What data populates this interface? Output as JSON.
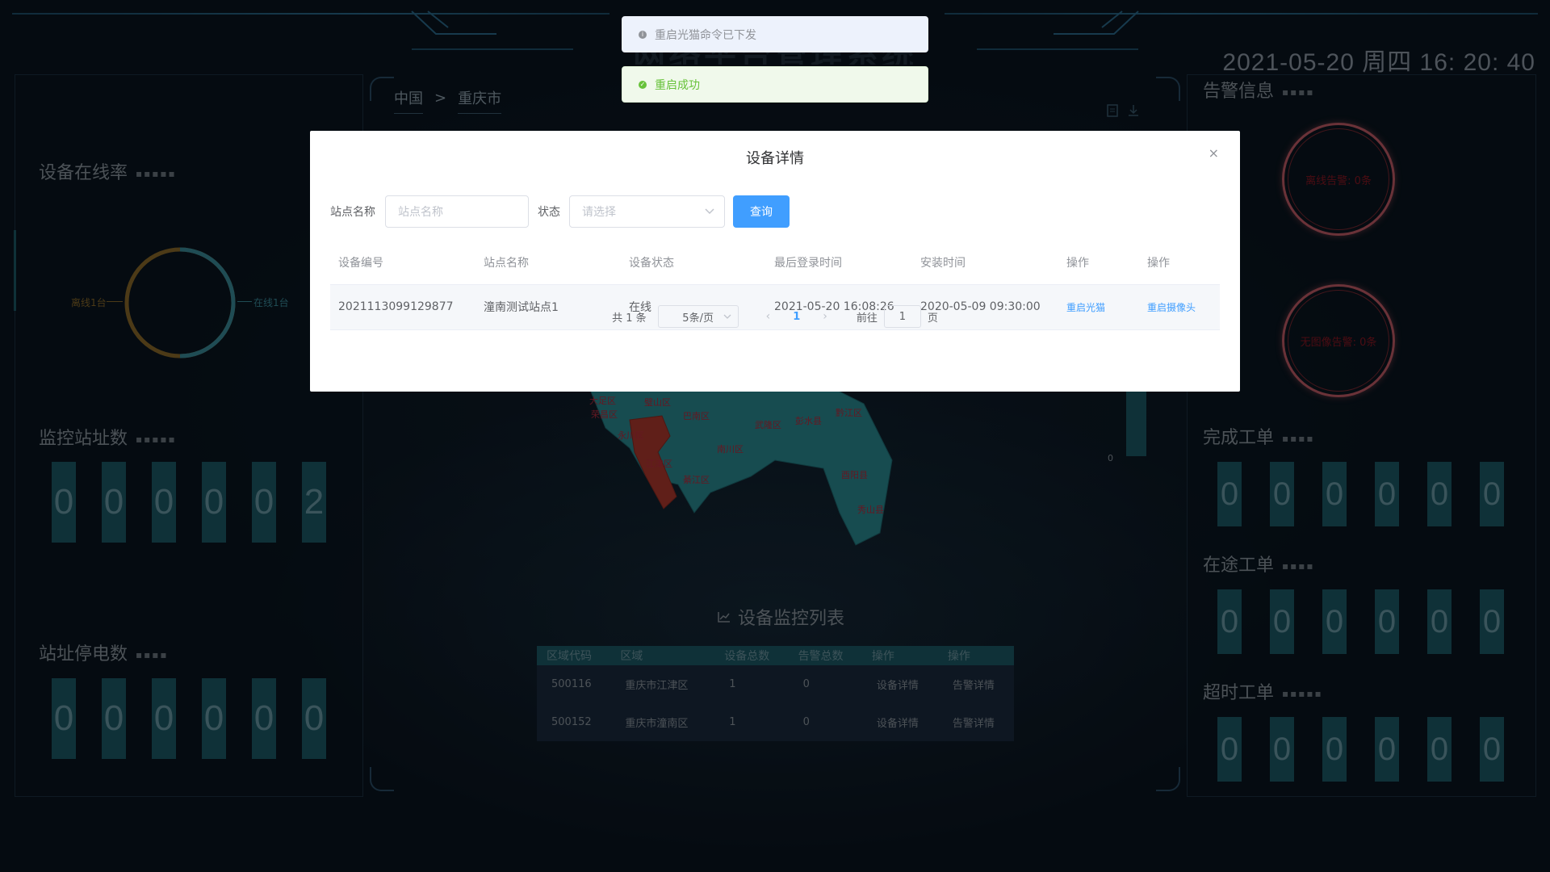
{
  "header": {
    "title": "网络平台管理系统",
    "datetime": "2021-05-20 周四 16: 20: 40"
  },
  "left_panel": {
    "online_rate": {
      "title": "设备在线率",
      "offline_label": "离线1台",
      "online_label": "在线1台",
      "offline_color": "#8a6a2a",
      "online_color": "#3a8a9a"
    },
    "station_count": {
      "title": "监控站址数",
      "digits": [
        "0",
        "0",
        "0",
        "0",
        "0",
        "2"
      ]
    },
    "power_outage": {
      "title": "站址停电数",
      "digits": [
        "0",
        "0",
        "0",
        "0",
        "0",
        "0"
      ]
    }
  },
  "right_panel": {
    "alerts": {
      "title": "告警信息",
      "offline_alert": "离线告警: 0条",
      "no_image_alert": "无图像告警: 0条"
    },
    "completed": {
      "title": "完成工单",
      "digits": [
        "0",
        "0",
        "0",
        "0",
        "0",
        "0"
      ]
    },
    "in_transit": {
      "title": "在途工单",
      "digits": [
        "0",
        "0",
        "0",
        "0",
        "0",
        "0"
      ]
    },
    "timeout": {
      "title": "超时工单",
      "digits": [
        "0",
        "0",
        "0",
        "0",
        "0",
        "0"
      ]
    }
  },
  "center": {
    "breadcrumb": [
      "中国",
      ">",
      "重庆市"
    ],
    "map_labels": [
      "大足区",
      "璧山区",
      "巴南区",
      "涪陵区",
      "丰都县",
      "忠县",
      "荣昌区",
      "南岸区",
      "武隆区",
      "彭水县",
      "黔江区",
      "永川区",
      "南川区",
      "江津区",
      "綦江区",
      "酉阳县",
      "秀山县"
    ],
    "highlight_color": "#b03a2e",
    "bar_zero": "0",
    "monitor_list": {
      "title": "设备监控列表",
      "columns": [
        "区域代码",
        "区域",
        "设备总数",
        "告警总数",
        "操作",
        "操作"
      ],
      "rows": [
        [
          "500116",
          "重庆市江津区",
          "1",
          "0",
          "设备详情",
          "告警详情"
        ],
        [
          "500152",
          "重庆市潼南区",
          "1",
          "0",
          "设备详情",
          "告警详情"
        ]
      ]
    }
  },
  "messages": {
    "info": "重启光猫命令已下发",
    "success": "重启成功"
  },
  "dialog": {
    "title": "设备详情",
    "close": "×",
    "form": {
      "station_label": "站点名称",
      "station_placeholder": "站点名称",
      "status_label": "状态",
      "status_placeholder": "请选择",
      "query": "查询"
    },
    "table": {
      "columns": [
        "设备编号",
        "站点名称",
        "设备状态",
        "最后登录时间",
        "安装时间",
        "操作",
        "操作"
      ],
      "rows": [
        [
          "2021113099129877",
          "潼南测试站点1",
          "在线",
          "2021-05-20 16:08:26",
          "2020-05-09 09:30:00",
          "重启光猫",
          "重启摄像头"
        ]
      ]
    },
    "pagination": {
      "total": "共 1 条",
      "page_size": "5条/页",
      "current": "1",
      "goto_prefix": "前往",
      "goto_value": "1",
      "goto_suffix": "页"
    }
  }
}
